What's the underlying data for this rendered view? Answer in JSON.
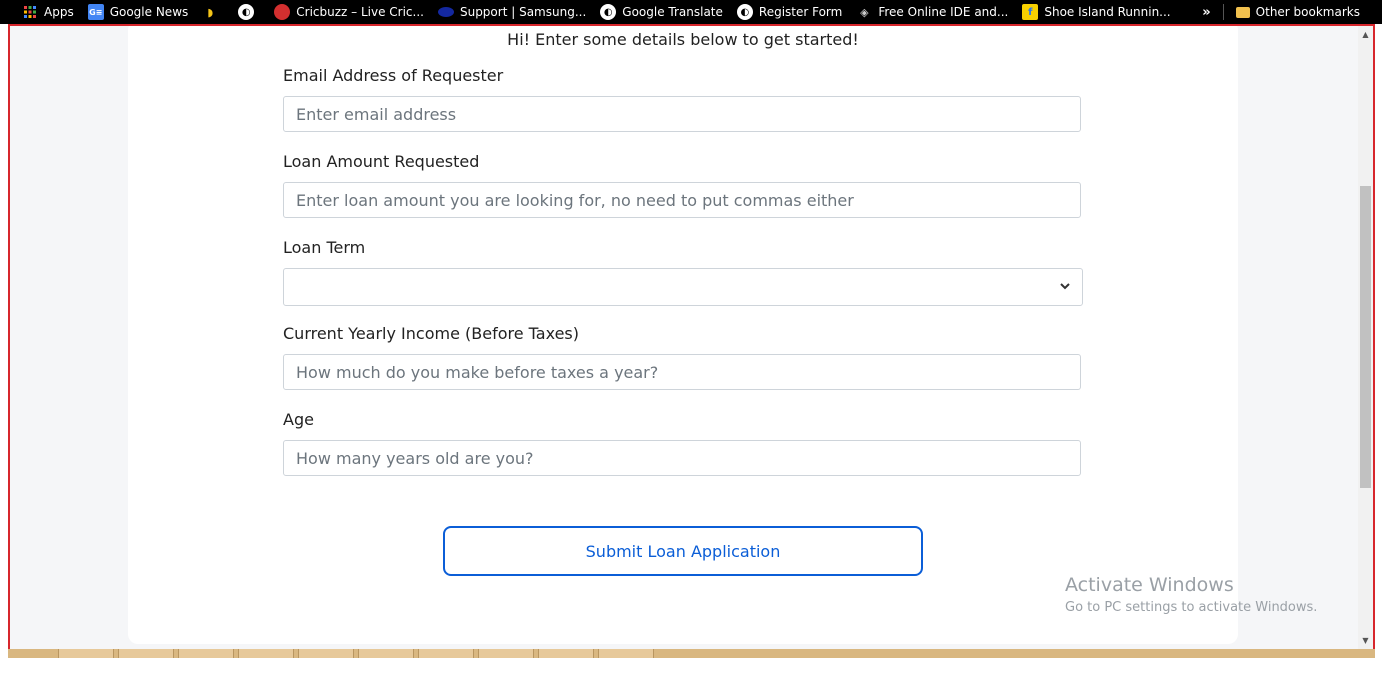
{
  "bookmarks": {
    "items": [
      {
        "label": "Apps",
        "icon": "apps-grid-icon"
      },
      {
        "label": "Google News",
        "icon": "google-news-icon"
      },
      {
        "label": "",
        "icon": "banana-icon"
      },
      {
        "label": "",
        "icon": "globe-icon"
      },
      {
        "label": "Cricbuzz – Live Cric...",
        "icon": "cricbuzz-icon"
      },
      {
        "label": "Support | Samsung...",
        "icon": "samsung-icon"
      },
      {
        "label": "Google Translate",
        "icon": "globe-icon"
      },
      {
        "label": "Register Form",
        "icon": "globe-icon"
      },
      {
        "label": "Free Online IDE and...",
        "icon": "ide-icon"
      },
      {
        "label": "Shoe Island Runnin...",
        "icon": "flipkart-icon"
      }
    ],
    "more": "»",
    "other": "Other bookmarks"
  },
  "form": {
    "intro": "Hi! Enter some details below to get started!",
    "email_label": "Email Address of Requester",
    "email_placeholder": "Enter email address",
    "loan_label": "Loan Amount Requested",
    "loan_placeholder": "Enter loan amount you are looking for, no need to put commas either",
    "term_label": "Loan Term",
    "term_value": "",
    "income_label": "Current Yearly Income (Before Taxes)",
    "income_placeholder": "How much do you make before taxes a year?",
    "age_label": "Age",
    "age_placeholder": "How many years old are you?",
    "submit_label": "Submit Loan Application"
  },
  "watermark": {
    "title": "Activate Windows",
    "subtitle": "Go to PC settings to activate Windows."
  },
  "colors": {
    "accent": "#0b5ed7",
    "frame_outline": "#d7262c"
  }
}
